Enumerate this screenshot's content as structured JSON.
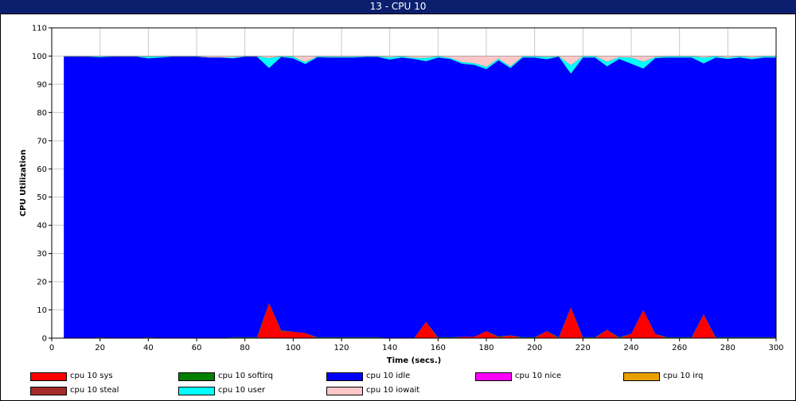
{
  "window": {
    "title": "13 - CPU 10"
  },
  "chart_data": {
    "type": "area",
    "stacked": true,
    "title": "13 - CPU 10",
    "xlabel": "Time (secs.)",
    "ylabel": "CPU Utilization",
    "xlim": [
      0,
      300
    ],
    "ylim": [
      0,
      110
    ],
    "xticks": [
      0,
      20,
      40,
      60,
      80,
      100,
      120,
      140,
      160,
      180,
      200,
      220,
      240,
      260,
      280,
      300
    ],
    "yticks": [
      0,
      10,
      20,
      30,
      40,
      50,
      60,
      70,
      80,
      90,
      100,
      110
    ],
    "grid": true,
    "legend_position": "bottom",
    "x": [
      5,
      10,
      15,
      20,
      25,
      30,
      35,
      40,
      45,
      50,
      55,
      60,
      65,
      70,
      75,
      80,
      85,
      90,
      95,
      100,
      105,
      110,
      115,
      120,
      125,
      130,
      135,
      140,
      145,
      150,
      155,
      160,
      165,
      170,
      175,
      180,
      185,
      190,
      195,
      200,
      205,
      210,
      215,
      220,
      225,
      230,
      235,
      240,
      245,
      250,
      255,
      260,
      265,
      270,
      275,
      280,
      285,
      290,
      295,
      300
    ],
    "series": [
      {
        "name": "cpu 10 sys",
        "color": "#ff0000",
        "values": [
          0,
          0,
          0,
          0,
          0,
          0,
          0,
          0,
          0,
          0,
          0,
          0,
          0,
          0,
          0,
          0,
          0,
          12.5,
          2.5,
          2.3,
          1.8,
          0,
          0,
          0,
          0,
          0,
          0,
          0,
          0,
          0,
          5.8,
          0,
          0,
          0.5,
          0.5,
          2.5,
          0.3,
          1,
          0,
          0,
          2.5,
          0,
          11,
          0,
          0,
          3,
          0,
          1.5,
          10,
          1.5,
          0,
          0,
          0,
          8.5,
          0,
          0,
          0,
          0,
          0,
          0
        ]
      },
      {
        "name": "cpu 10 softirq",
        "color": "#008000",
        "values": [
          0,
          0,
          0,
          0.3,
          0,
          0,
          0,
          0.3,
          0,
          0,
          0,
          0,
          0,
          0,
          0.3,
          0.3,
          0.3,
          0,
          0.3,
          0,
          0,
          0.3,
          0.3,
          0.3,
          0.3,
          0.3,
          0.3,
          0,
          0,
          0,
          0,
          0.3,
          0.3,
          0,
          0,
          0,
          0.3,
          0,
          0.3,
          0.3,
          0,
          0.3,
          0,
          0.3,
          0.3,
          0,
          0.3,
          0,
          0,
          0,
          0.3,
          0.3,
          0.3,
          0,
          0.3,
          0.3,
          0.3,
          0.3,
          0.3,
          0.3
        ]
      },
      {
        "name": "cpu 10 idle",
        "color": "#0000ff",
        "values": [
          99.8,
          99.8,
          99.8,
          99.3,
          99.8,
          99.8,
          99.8,
          98.9,
          99.5,
          99.8,
          99.8,
          99.8,
          99.5,
          99.5,
          98.9,
          99.5,
          99.5,
          83.3,
          96.9,
          96.9,
          95.4,
          99.3,
          99.2,
          99.2,
          99.2,
          99.4,
          99.4,
          98.8,
          99.5,
          99,
          92.4,
          99.2,
          98.7,
          96.8,
          96.4,
          92.9,
          97.9,
          94.8,
          99.2,
          99.2,
          96.4,
          99.5,
          82.8,
          99.2,
          99.2,
          93.4,
          98.7,
          95.8,
          85.6,
          97.8,
          99.2,
          99.2,
          99.2,
          88.9,
          99.2,
          98.7,
          99.2,
          98.6,
          99.2,
          99.2
        ]
      },
      {
        "name": "cpu 10 nice",
        "color": "#ff00ff",
        "values": []
      },
      {
        "name": "cpu 10 irq",
        "color": "#e8a000",
        "values": []
      },
      {
        "name": "cpu 10 steal",
        "color": "#a52a2a",
        "values": []
      },
      {
        "name": "cpu 10 user",
        "color": "#00ffff",
        "values": [
          0.1,
          0.1,
          0.1,
          0.3,
          0.1,
          0.1,
          0.1,
          0.6,
          0.4,
          0.1,
          0.1,
          0.1,
          0.1,
          0.1,
          0.4,
          0.1,
          0.1,
          3.5,
          0.2,
          0.6,
          0.7,
          0.3,
          0.3,
          0.3,
          0.3,
          0.2,
          0.2,
          0.8,
          0.4,
          0.4,
          1.2,
          0.4,
          0.4,
          0.6,
          0.6,
          0.8,
          0.6,
          0.6,
          0.4,
          0.4,
          0.8,
          0.1,
          3,
          0.4,
          0.4,
          1.6,
          0.6,
          2.2,
          2.4,
          0.4,
          0.4,
          0.4,
          0.4,
          2.1,
          0.4,
          0.5,
          0.4,
          0.6,
          0.4,
          0.4
        ]
      },
      {
        "name": "cpu 10 iowait",
        "color": "#ffc8c8",
        "values": [
          0.1,
          0.1,
          0.1,
          0.1,
          0.1,
          0.1,
          0.1,
          0.2,
          0.1,
          0.1,
          0.1,
          0.1,
          0.4,
          0.4,
          0.4,
          0.1,
          0.1,
          0.7,
          0.1,
          0.2,
          2.1,
          0.1,
          0.2,
          0.2,
          0.2,
          0.1,
          0.1,
          0.4,
          0.1,
          0.6,
          0.6,
          0.1,
          0.6,
          2.1,
          2.5,
          3.8,
          0.9,
          3.6,
          0.1,
          0.1,
          0.3,
          0.1,
          3.2,
          0.1,
          0.1,
          2,
          0.4,
          0.5,
          2,
          0.3,
          0.1,
          0.1,
          0.1,
          0.5,
          0.1,
          0.5,
          0.1,
          0.5,
          0.1,
          0.1
        ]
      }
    ]
  }
}
